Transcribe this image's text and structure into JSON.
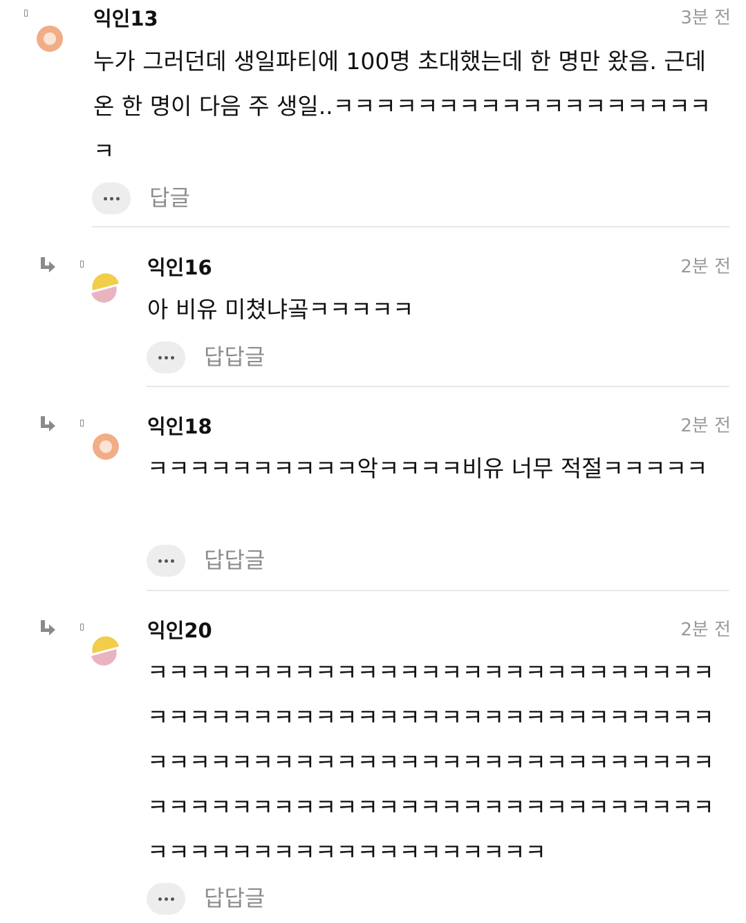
{
  "comments": [
    {
      "author": "익인13",
      "time": "3분 전",
      "body": "누가 그러던데 생일파티에 100명 초대했는데 한 명만 왔음. 근데 온 한 명이 다음 주 생일..ㅋㅋㅋㅋㅋㅋㅋㅋㅋㅋㅋㅋㅋㅋㅋㅋㅋㅋㅋ",
      "reply_label": "답글",
      "avatar": "ring-avatar-icon",
      "is_reply": false
    },
    {
      "author": "익인16",
      "time": "2분 전",
      "body": "아 비유 미쳤냐곸ㅋㅋㅋㅋㅋ",
      "reply_label": "답답글",
      "avatar": "split-circle-avatar-icon",
      "is_reply": true
    },
    {
      "author": "익인18",
      "time": "2분 전",
      "body": "ㅋㅋㅋㅋㅋㅋㅋㅋㅋㅋ악ㅋㅋㅋㅋ비유 너무 적절ㅋㅋㅋㅋㅋ",
      "reply_label": "답답글",
      "avatar": "ring-avatar-icon",
      "is_reply": true
    },
    {
      "author": "익인20",
      "time": "2분 전",
      "body": "ㅋㅋㅋㅋㅋㅋㅋㅋㅋㅋㅋㅋㅋㅋㅋㅋㅋㅋㅋㅋㅋㅋㅋㅋㅋㅋㅋㅋㅋㅋㅋㅋㅋㅋㅋㅋㅋㅋㅋㅋㅋㅋㅋㅋㅋㅋㅋㅋㅋㅋㅋㅋㅋㅋㅋㅋㅋㅋㅋㅋㅋㅋㅋㅋㅋㅋㅋㅋㅋㅋㅋㅋㅋㅋㅋㅋㅋㅋㅋㅋㅋㅋㅋㅋㅋㅋㅋㅋㅋㅋㅋㅋㅋㅋㅋㅋㅋㅋㅋㅋㅋㅋㅋㅋㅋㅋㅋㅋㅋㅋㅋㅋㅋㅋㅋㅋㅋㅋㅋㅋㅋㅋㅋㅋㅋㅋㅋ",
      "reply_label": "답답글",
      "avatar": "split-circle-avatar-icon",
      "is_reply": true
    }
  ],
  "colors": {
    "ring_avatar_outer": "#f0ad86",
    "ring_avatar_inner": "#fbe3d6",
    "split_avatar_top": "#f2cd4a",
    "split_avatar_bottom": "#eab3c0",
    "muted_text": "#9a9a9a",
    "divider": "#e8e8e8",
    "button_bg": "#ededed"
  }
}
